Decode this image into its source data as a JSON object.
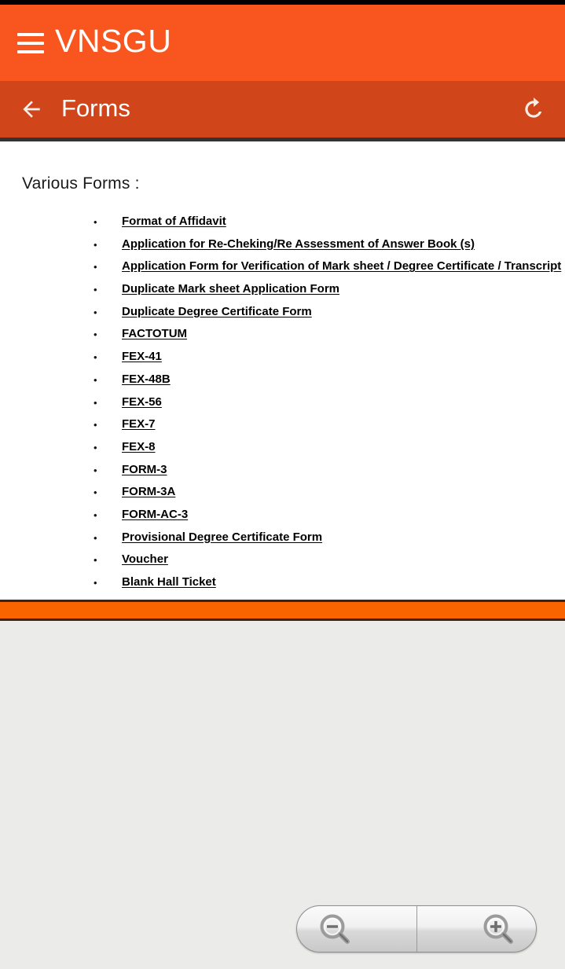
{
  "app_bar": {
    "menu_icon": "hamburger-menu-icon",
    "brand": "VNSGU",
    "background_color": "#f9551f"
  },
  "sub_bar": {
    "back_icon": "back-arrow-icon",
    "title": "Forms",
    "refresh_icon": "refresh-icon",
    "background_color": "#d1451b"
  },
  "content": {
    "heading": "Various Forms :",
    "bullet_glyph": "•",
    "links": [
      {
        "label": "Format of Affidavit"
      },
      {
        "label": "Application for Re-Cheking/Re Assessment of Answer Book (s)"
      },
      {
        "label": "Application Form for Verification of Mark sheet / Degree Certificate / Transcript"
      },
      {
        "label": "Duplicate Mark sheet Application Form"
      },
      {
        "label": "Duplicate Degree Certificate Form"
      },
      {
        "label": "FACTOTUM"
      },
      {
        "label": "FEX-41"
      },
      {
        "label": "FEX-48B"
      },
      {
        "label": "FEX-56"
      },
      {
        "label": "FEX-7"
      },
      {
        "label": "FEX-8"
      },
      {
        "label": "FORM-3"
      },
      {
        "label": "FORM-3A"
      },
      {
        "label": "FORM-AC-3"
      },
      {
        "label": "Provisional Degree Certificate Form"
      },
      {
        "label": "Voucher"
      },
      {
        "label": "Blank Hall Ticket"
      }
    ]
  },
  "footer": {
    "accent_color": "#fa6400"
  },
  "zoom_controls": {
    "zoom_out_icon": "zoom-out-magnifier-icon",
    "zoom_in_icon": "zoom-in-magnifier-icon"
  }
}
